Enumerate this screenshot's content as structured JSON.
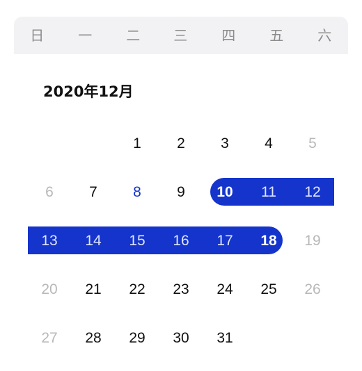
{
  "calendar": {
    "weekdays": [
      "日",
      "一",
      "二",
      "三",
      "四",
      "五",
      "六"
    ],
    "month_title": "2020年12月",
    "accent_color": "#1434cc",
    "header_bg": "#f2f2f4",
    "range": {
      "start": 10,
      "end": 18
    },
    "today": 8,
    "days": [
      {
        "label": "1",
        "col": 2,
        "row": 0,
        "state": "normal"
      },
      {
        "label": "2",
        "col": 3,
        "row": 0,
        "state": "normal"
      },
      {
        "label": "3",
        "col": 4,
        "row": 0,
        "state": "normal"
      },
      {
        "label": "4",
        "col": 5,
        "row": 0,
        "state": "normal"
      },
      {
        "label": "5",
        "col": 6,
        "row": 0,
        "state": "muted"
      },
      {
        "label": "6",
        "col": 0,
        "row": 1,
        "state": "muted"
      },
      {
        "label": "7",
        "col": 1,
        "row": 1,
        "state": "normal"
      },
      {
        "label": "8",
        "col": 2,
        "row": 1,
        "state": "today"
      },
      {
        "label": "9",
        "col": 3,
        "row": 1,
        "state": "normal"
      },
      {
        "label": "10",
        "col": 4,
        "row": 1,
        "state": "endpoint"
      },
      {
        "label": "11",
        "col": 5,
        "row": 1,
        "state": "in-range"
      },
      {
        "label": "12",
        "col": 6,
        "row": 1,
        "state": "in-range"
      },
      {
        "label": "13",
        "col": 0,
        "row": 2,
        "state": "in-range"
      },
      {
        "label": "14",
        "col": 1,
        "row": 2,
        "state": "in-range"
      },
      {
        "label": "15",
        "col": 2,
        "row": 2,
        "state": "in-range"
      },
      {
        "label": "16",
        "col": 3,
        "row": 2,
        "state": "in-range"
      },
      {
        "label": "17",
        "col": 4,
        "row": 2,
        "state": "in-range"
      },
      {
        "label": "18",
        "col": 5,
        "row": 2,
        "state": "endpoint"
      },
      {
        "label": "19",
        "col": 6,
        "row": 2,
        "state": "muted"
      },
      {
        "label": "20",
        "col": 0,
        "row": 3,
        "state": "muted"
      },
      {
        "label": "21",
        "col": 1,
        "row": 3,
        "state": "normal"
      },
      {
        "label": "22",
        "col": 2,
        "row": 3,
        "state": "normal"
      },
      {
        "label": "23",
        "col": 3,
        "row": 3,
        "state": "normal"
      },
      {
        "label": "24",
        "col": 4,
        "row": 3,
        "state": "normal"
      },
      {
        "label": "25",
        "col": 5,
        "row": 3,
        "state": "normal"
      },
      {
        "label": "26",
        "col": 6,
        "row": 3,
        "state": "muted"
      },
      {
        "label": "27",
        "col": 0,
        "row": 4,
        "state": "muted"
      },
      {
        "label": "28",
        "col": 1,
        "row": 4,
        "state": "normal"
      },
      {
        "label": "29",
        "col": 2,
        "row": 4,
        "state": "normal"
      },
      {
        "label": "30",
        "col": 3,
        "row": 4,
        "state": "normal"
      },
      {
        "label": "31",
        "col": 4,
        "row": 4,
        "state": "normal"
      }
    ]
  }
}
